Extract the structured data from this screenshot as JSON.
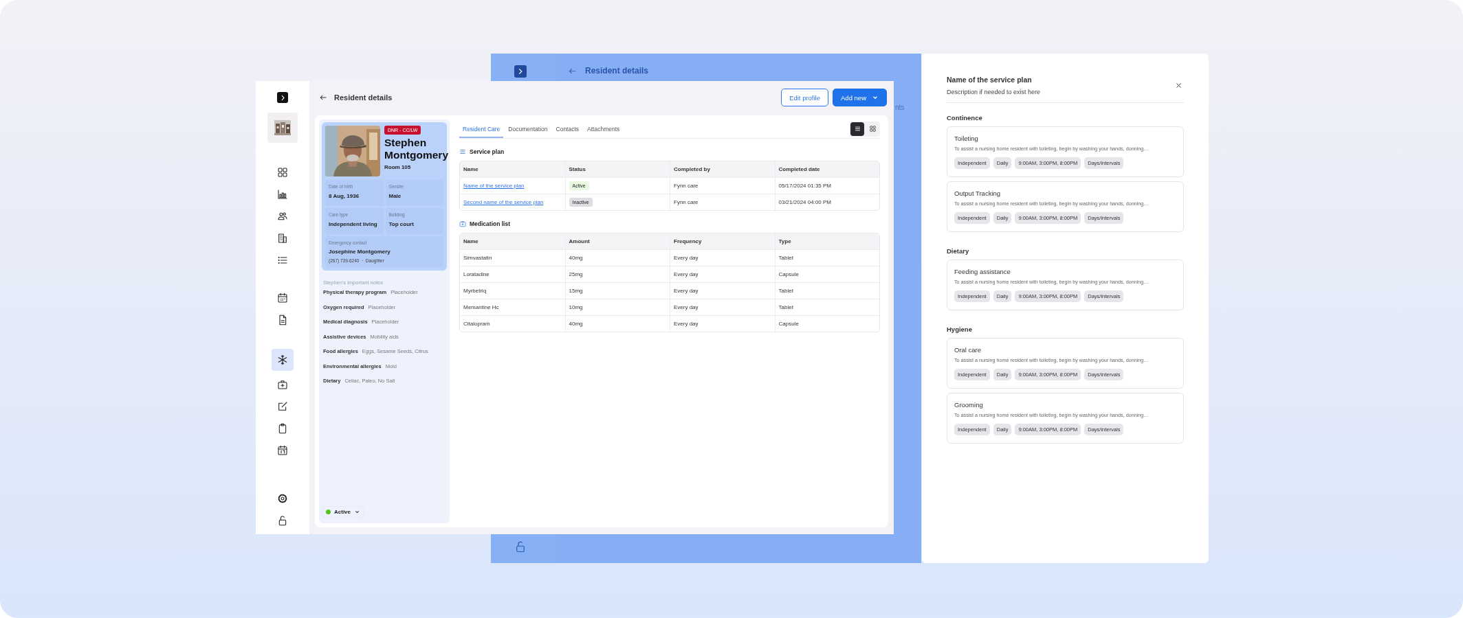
{
  "background_window": {
    "title": "Resident details",
    "partial_text": "nts"
  },
  "window": {
    "title": "Resident details",
    "buttons": [
      {
        "label": "Edit profile",
        "kind": "outline"
      },
      {
        "label": "Add new",
        "kind": "primary"
      }
    ],
    "sidebar": {
      "groups": [
        {
          "items": [
            {
              "selected": false
            },
            {
              "selected": false
            },
            {
              "selected": false
            },
            {
              "selected": false
            },
            {
              "selected": false
            }
          ]
        },
        {
          "items": [
            {
              "selected": false
            },
            {
              "selected": false
            }
          ]
        },
        {
          "items": [
            {
              "selected": true
            },
            {
              "selected": false
            },
            {
              "selected": false
            },
            {
              "selected": false
            },
            {
              "selected": false
            }
          ]
        },
        {
          "items": [
            {
              "selected": false
            },
            {
              "selected": false
            }
          ]
        }
      ]
    },
    "profile": {
      "badge": "DNR - CC/LW",
      "name": "Stephen Montgomery",
      "room": "Room 105",
      "fields": [
        {
          "label": "Date of birth",
          "value": "8 Aug, 1936"
        },
        {
          "label": "Gender",
          "value": "Male"
        },
        {
          "label": "Care type",
          "value": "Independent living"
        },
        {
          "label": "Building",
          "value": "Top court"
        }
      ],
      "emergency": {
        "label": "Emergency contact",
        "name": "Josephine Montgomery",
        "details": "(267) 739-6240  ·  Daughter"
      },
      "notes_title": "Stephen's important notes",
      "notes": [
        {
          "label": "Physical therapy program",
          "value": "Placeholder"
        },
        {
          "label": "Oxygen required",
          "value": "Placeholder"
        },
        {
          "label": "Medical diagnosis",
          "value": "Placeholder"
        },
        {
          "label": "Assistive devices",
          "value": "Mobility aids"
        },
        {
          "label": "Food allergies",
          "value": "Eggs, Sesame Seeds, Citrus"
        },
        {
          "label": "Environmental allergies",
          "value": "Mold"
        },
        {
          "label": "Dietary",
          "value": "Celiac, Paleo, No Salt"
        }
      ],
      "status": {
        "label": "Active",
        "color": "#52c41a"
      }
    },
    "tabs": [
      {
        "label": "Resident Care",
        "selected": true
      },
      {
        "label": "Documentation",
        "selected": false
      },
      {
        "label": "Contacts",
        "selected": false
      },
      {
        "label": "Attachments",
        "selected": false
      }
    ],
    "view_toggle": [
      {
        "kind": "list",
        "selected": true
      },
      {
        "kind": "grid",
        "selected": false
      }
    ],
    "service_plan": {
      "title": "Service plan",
      "columns": [
        "Name",
        "Status",
        "Completed by",
        "Completed date"
      ],
      "rows": [
        {
          "name": "Name of the service plan",
          "status": {
            "label": "Active",
            "kind": "active"
          },
          "completed_by": "Fynn care",
          "completed_date": "05/17/2024 01:35 PM"
        },
        {
          "name": "Second name of the service plan",
          "status": {
            "label": "Inactive",
            "kind": "inactive"
          },
          "completed_by": "Fynn care",
          "completed_date": "03/21/2024 04:00 PM"
        }
      ]
    },
    "medication_list": {
      "title": "Medication list",
      "columns": [
        "Name",
        "Amount",
        "Frequency",
        "Type"
      ],
      "rows": [
        [
          "Simvastatin",
          "40mg",
          "Every day",
          "Tablet"
        ],
        [
          "Loratadine",
          "25mg",
          "Every day",
          "Capsule"
        ],
        [
          "Myrbetriq",
          "15mg",
          "Every day",
          "Tablet"
        ],
        [
          "Memantine Hc",
          "10mg",
          "Every day",
          "Tablet"
        ],
        [
          "Citalopram",
          "40mg",
          "Every day",
          "Capsule"
        ]
      ]
    }
  },
  "panel": {
    "title": "Name of the service plan",
    "description": "Description if needed to exist here",
    "sections": [
      {
        "title": "Continence",
        "cards": [
          {
            "title": "Toileting",
            "description": "To assist a nursing home resident with toileting, begin by washing your hands, donning…",
            "tags": [
              "Independent",
              "Daily",
              "9:00AM, 3:00PM, 8:00PM",
              "Days/intervals"
            ]
          },
          {
            "title": "Output Tracking",
            "description": "To assist a nursing home resident with toileting, begin by washing your hands, donning…",
            "tags": [
              "Independent",
              "Daily",
              "9:00AM, 3:00PM, 8:00PM",
              "Days/intervals"
            ]
          }
        ]
      },
      {
        "title": "Dietary",
        "cards": [
          {
            "title": "Feeding assistance",
            "description": "To assist a nursing home resident with toileting, begin by washing your hands, donning…",
            "tags": [
              "Independent",
              "Daily",
              "9:00AM, 3:00PM, 8:00PM",
              "Days/intervals"
            ]
          }
        ]
      },
      {
        "title": "Hygiene",
        "cards": [
          {
            "title": "Oral care",
            "description": "To assist a nursing home resident with toileting, begin by washing your hands, donning…",
            "tags": [
              "Independent",
              "Daily",
              "9:00AM, 3:00PM, 8:00PM",
              "Days/intervals"
            ]
          },
          {
            "title": "Grooming",
            "description": "To assist a nursing home resident with toileting, begin by washing your hands, donning…",
            "tags": [
              "Independent",
              "Daily",
              "9:00AM, 3:00PM, 8:00PM",
              "Days/intervals"
            ]
          }
        ]
      }
    ]
  }
}
